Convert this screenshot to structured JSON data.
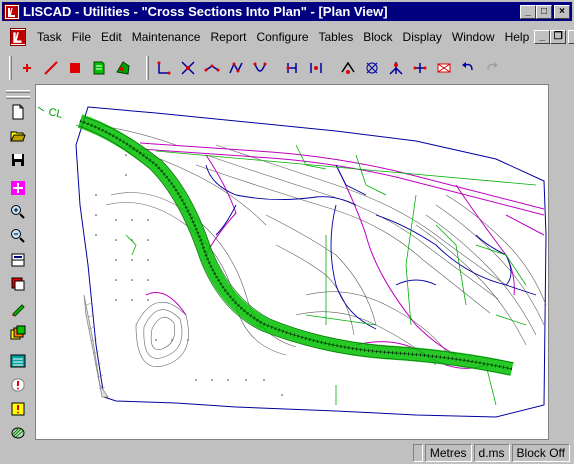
{
  "window": {
    "title": "LISCAD - Utilities - \"Cross Sections Into Plan\" - [Plan View]",
    "controls": {
      "minimize": "_",
      "maximize": "□",
      "close": "×"
    }
  },
  "menubar": {
    "items": [
      "Task",
      "File",
      "Edit",
      "Maintenance",
      "Report",
      "Configure",
      "Tables",
      "Block",
      "Display",
      "Window",
      "Help"
    ],
    "doc_controls": {
      "minimize": "_",
      "restore": "❐",
      "close": "×"
    }
  },
  "canvas": {
    "label": "CL"
  },
  "statusbar": {
    "units": "Metres",
    "angle_format": "d.ms",
    "block": "Block Off"
  },
  "colors": {
    "titlebar": "#000080",
    "chrome": "#c0c0c0",
    "road": "#00c000",
    "magenta": "#c000c0",
    "blue": "#0000a0",
    "contour": "#606060"
  }
}
